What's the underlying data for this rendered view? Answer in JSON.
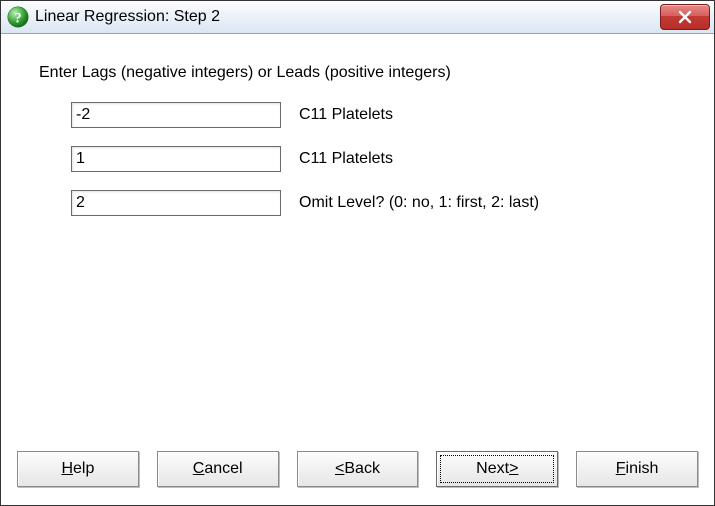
{
  "window": {
    "title": "Linear Regression: Step 2",
    "icon": "question-icon"
  },
  "instruction": "Enter Lags (negative integers) or Leads (positive integers)",
  "fields": [
    {
      "value": "-2",
      "label": "C11 Platelets"
    },
    {
      "value": "1",
      "label": "C11 Platelets"
    },
    {
      "value": "2",
      "label": "Omit Level? (0: no, 1: first, 2: last)"
    }
  ],
  "buttons": {
    "help": {
      "pre": "",
      "hot": "H",
      "post": "elp"
    },
    "cancel": {
      "pre": "",
      "hot": "C",
      "post": "ancel"
    },
    "back": {
      "pre": "",
      "hot": "<",
      "post": " Back"
    },
    "next": {
      "pre": "Next ",
      "hot": ">",
      "post": ""
    },
    "finish": {
      "pre": "",
      "hot": "F",
      "post": "inish"
    }
  }
}
